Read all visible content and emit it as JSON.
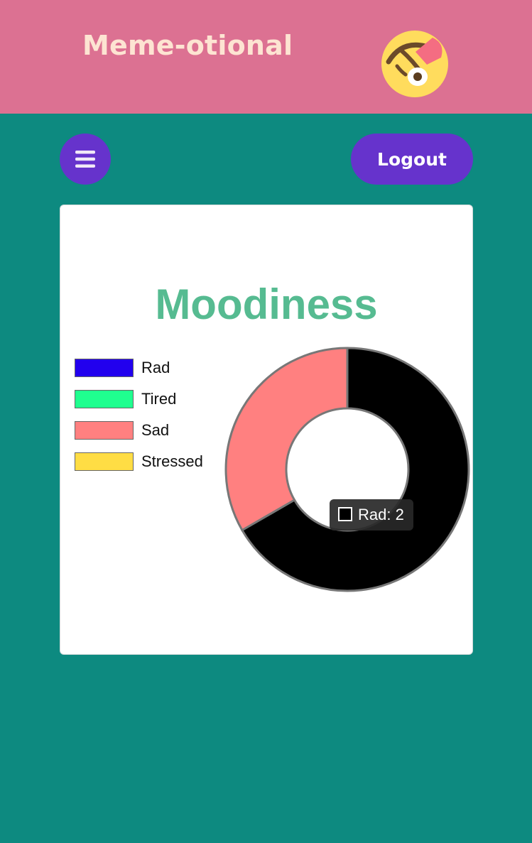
{
  "app": {
    "brand": "Meme-otional",
    "logo_icon": "dizzy-face-emoji-icon"
  },
  "nav": {
    "menu_icon": "hamburger-menu-icon",
    "logout_label": "Logout"
  },
  "chart_data": {
    "type": "doughnut",
    "title": "Moodiness",
    "legend_position": "left",
    "categories": [
      "Rad",
      "Tired",
      "Sad",
      "Stressed"
    ],
    "values": [
      2,
      0,
      1,
      0
    ],
    "colors": [
      "#000000",
      "#1fff8f",
      "#ff8080",
      "#ffdd44"
    ],
    "legend_colors": [
      "#2200ee",
      "#1fff8f",
      "#ff8080",
      "#ffdd44"
    ],
    "highlighted": "Rad",
    "tooltip": "Rad: 2"
  }
}
